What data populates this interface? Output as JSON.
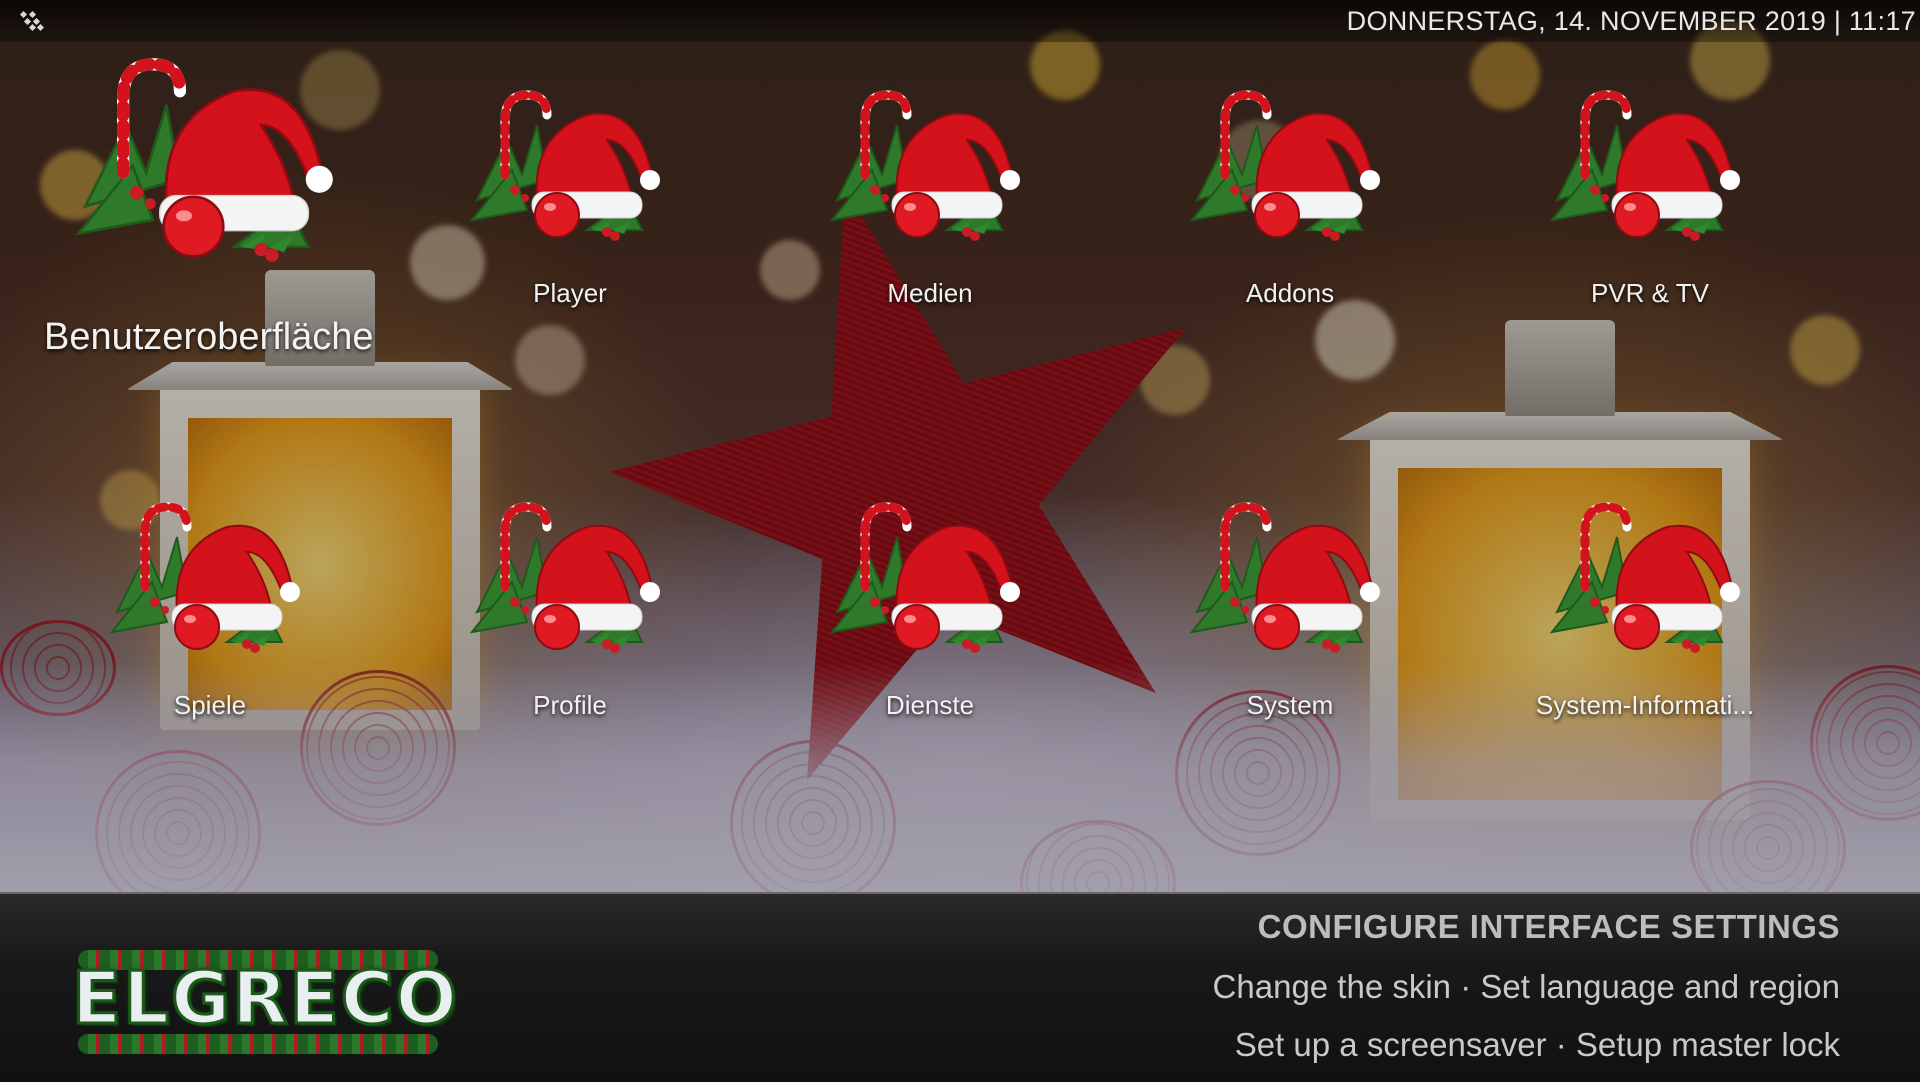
{
  "header": {
    "datetime": "DONNERSTAG, 14. NOVEMBER 2019 | 11:17",
    "menu_icon": "kodi-settings-icon"
  },
  "tiles": [
    {
      "label": "Benutzeroberfläche",
      "icon": "santa-hat-icon",
      "focused": true
    },
    {
      "label": "Player",
      "icon": "santa-hat-icon"
    },
    {
      "label": "Medien",
      "icon": "santa-hat-icon"
    },
    {
      "label": "Addons",
      "icon": "santa-hat-icon"
    },
    {
      "label": "PVR & TV",
      "icon": "santa-hat-icon"
    },
    {
      "label": "Spiele",
      "icon": "santa-hat-icon"
    },
    {
      "label": "Profile",
      "icon": "santa-hat-icon"
    },
    {
      "label": "Dienste",
      "icon": "santa-hat-icon"
    },
    {
      "label": "System",
      "icon": "santa-hat-icon"
    },
    {
      "label": "System-Informati...",
      "icon": "santa-hat-icon"
    }
  ],
  "info": {
    "title": "CONFIGURE INTERFACE SETTINGS",
    "line1": "Change the skin · Set language and region",
    "line2": "Set up a screensaver · Setup master lock"
  },
  "logo": {
    "text": "ELGRECO"
  },
  "colors": {
    "label": "#f2f2f2",
    "info_title": "#bdbdbd",
    "info_text": "#c9c9c9",
    "hat_red": "#d3121c",
    "pine_green": "#2f7a2a"
  }
}
